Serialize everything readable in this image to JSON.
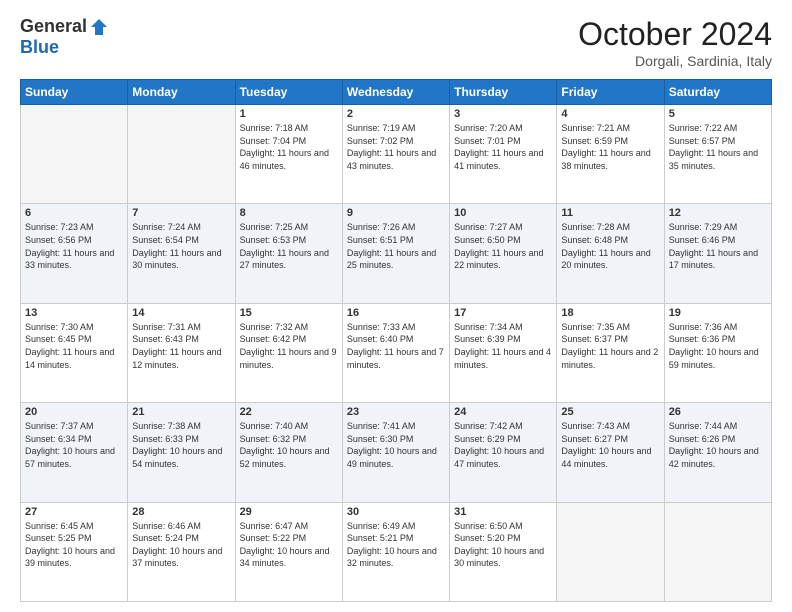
{
  "header": {
    "logo_general": "General",
    "logo_blue": "Blue",
    "month_title": "October 2024",
    "location": "Dorgali, Sardinia, Italy"
  },
  "days_of_week": [
    "Sunday",
    "Monday",
    "Tuesday",
    "Wednesday",
    "Thursday",
    "Friday",
    "Saturday"
  ],
  "weeks": [
    [
      {
        "day": "",
        "info": ""
      },
      {
        "day": "",
        "info": ""
      },
      {
        "day": "1",
        "info": "Sunrise: 7:18 AM\nSunset: 7:04 PM\nDaylight: 11 hours and 46 minutes."
      },
      {
        "day": "2",
        "info": "Sunrise: 7:19 AM\nSunset: 7:02 PM\nDaylight: 11 hours and 43 minutes."
      },
      {
        "day": "3",
        "info": "Sunrise: 7:20 AM\nSunset: 7:01 PM\nDaylight: 11 hours and 41 minutes."
      },
      {
        "day": "4",
        "info": "Sunrise: 7:21 AM\nSunset: 6:59 PM\nDaylight: 11 hours and 38 minutes."
      },
      {
        "day": "5",
        "info": "Sunrise: 7:22 AM\nSunset: 6:57 PM\nDaylight: 11 hours and 35 minutes."
      }
    ],
    [
      {
        "day": "6",
        "info": "Sunrise: 7:23 AM\nSunset: 6:56 PM\nDaylight: 11 hours and 33 minutes."
      },
      {
        "day": "7",
        "info": "Sunrise: 7:24 AM\nSunset: 6:54 PM\nDaylight: 11 hours and 30 minutes."
      },
      {
        "day": "8",
        "info": "Sunrise: 7:25 AM\nSunset: 6:53 PM\nDaylight: 11 hours and 27 minutes."
      },
      {
        "day": "9",
        "info": "Sunrise: 7:26 AM\nSunset: 6:51 PM\nDaylight: 11 hours and 25 minutes."
      },
      {
        "day": "10",
        "info": "Sunrise: 7:27 AM\nSunset: 6:50 PM\nDaylight: 11 hours and 22 minutes."
      },
      {
        "day": "11",
        "info": "Sunrise: 7:28 AM\nSunset: 6:48 PM\nDaylight: 11 hours and 20 minutes."
      },
      {
        "day": "12",
        "info": "Sunrise: 7:29 AM\nSunset: 6:46 PM\nDaylight: 11 hours and 17 minutes."
      }
    ],
    [
      {
        "day": "13",
        "info": "Sunrise: 7:30 AM\nSunset: 6:45 PM\nDaylight: 11 hours and 14 minutes."
      },
      {
        "day": "14",
        "info": "Sunrise: 7:31 AM\nSunset: 6:43 PM\nDaylight: 11 hours and 12 minutes."
      },
      {
        "day": "15",
        "info": "Sunrise: 7:32 AM\nSunset: 6:42 PM\nDaylight: 11 hours and 9 minutes."
      },
      {
        "day": "16",
        "info": "Sunrise: 7:33 AM\nSunset: 6:40 PM\nDaylight: 11 hours and 7 minutes."
      },
      {
        "day": "17",
        "info": "Sunrise: 7:34 AM\nSunset: 6:39 PM\nDaylight: 11 hours and 4 minutes."
      },
      {
        "day": "18",
        "info": "Sunrise: 7:35 AM\nSunset: 6:37 PM\nDaylight: 11 hours and 2 minutes."
      },
      {
        "day": "19",
        "info": "Sunrise: 7:36 AM\nSunset: 6:36 PM\nDaylight: 10 hours and 59 minutes."
      }
    ],
    [
      {
        "day": "20",
        "info": "Sunrise: 7:37 AM\nSunset: 6:34 PM\nDaylight: 10 hours and 57 minutes."
      },
      {
        "day": "21",
        "info": "Sunrise: 7:38 AM\nSunset: 6:33 PM\nDaylight: 10 hours and 54 minutes."
      },
      {
        "day": "22",
        "info": "Sunrise: 7:40 AM\nSunset: 6:32 PM\nDaylight: 10 hours and 52 minutes."
      },
      {
        "day": "23",
        "info": "Sunrise: 7:41 AM\nSunset: 6:30 PM\nDaylight: 10 hours and 49 minutes."
      },
      {
        "day": "24",
        "info": "Sunrise: 7:42 AM\nSunset: 6:29 PM\nDaylight: 10 hours and 47 minutes."
      },
      {
        "day": "25",
        "info": "Sunrise: 7:43 AM\nSunset: 6:27 PM\nDaylight: 10 hours and 44 minutes."
      },
      {
        "day": "26",
        "info": "Sunrise: 7:44 AM\nSunset: 6:26 PM\nDaylight: 10 hours and 42 minutes."
      }
    ],
    [
      {
        "day": "27",
        "info": "Sunrise: 6:45 AM\nSunset: 5:25 PM\nDaylight: 10 hours and 39 minutes."
      },
      {
        "day": "28",
        "info": "Sunrise: 6:46 AM\nSunset: 5:24 PM\nDaylight: 10 hours and 37 minutes."
      },
      {
        "day": "29",
        "info": "Sunrise: 6:47 AM\nSunset: 5:22 PM\nDaylight: 10 hours and 34 minutes."
      },
      {
        "day": "30",
        "info": "Sunrise: 6:49 AM\nSunset: 5:21 PM\nDaylight: 10 hours and 32 minutes."
      },
      {
        "day": "31",
        "info": "Sunrise: 6:50 AM\nSunset: 5:20 PM\nDaylight: 10 hours and 30 minutes."
      },
      {
        "day": "",
        "info": ""
      },
      {
        "day": "",
        "info": ""
      }
    ]
  ]
}
